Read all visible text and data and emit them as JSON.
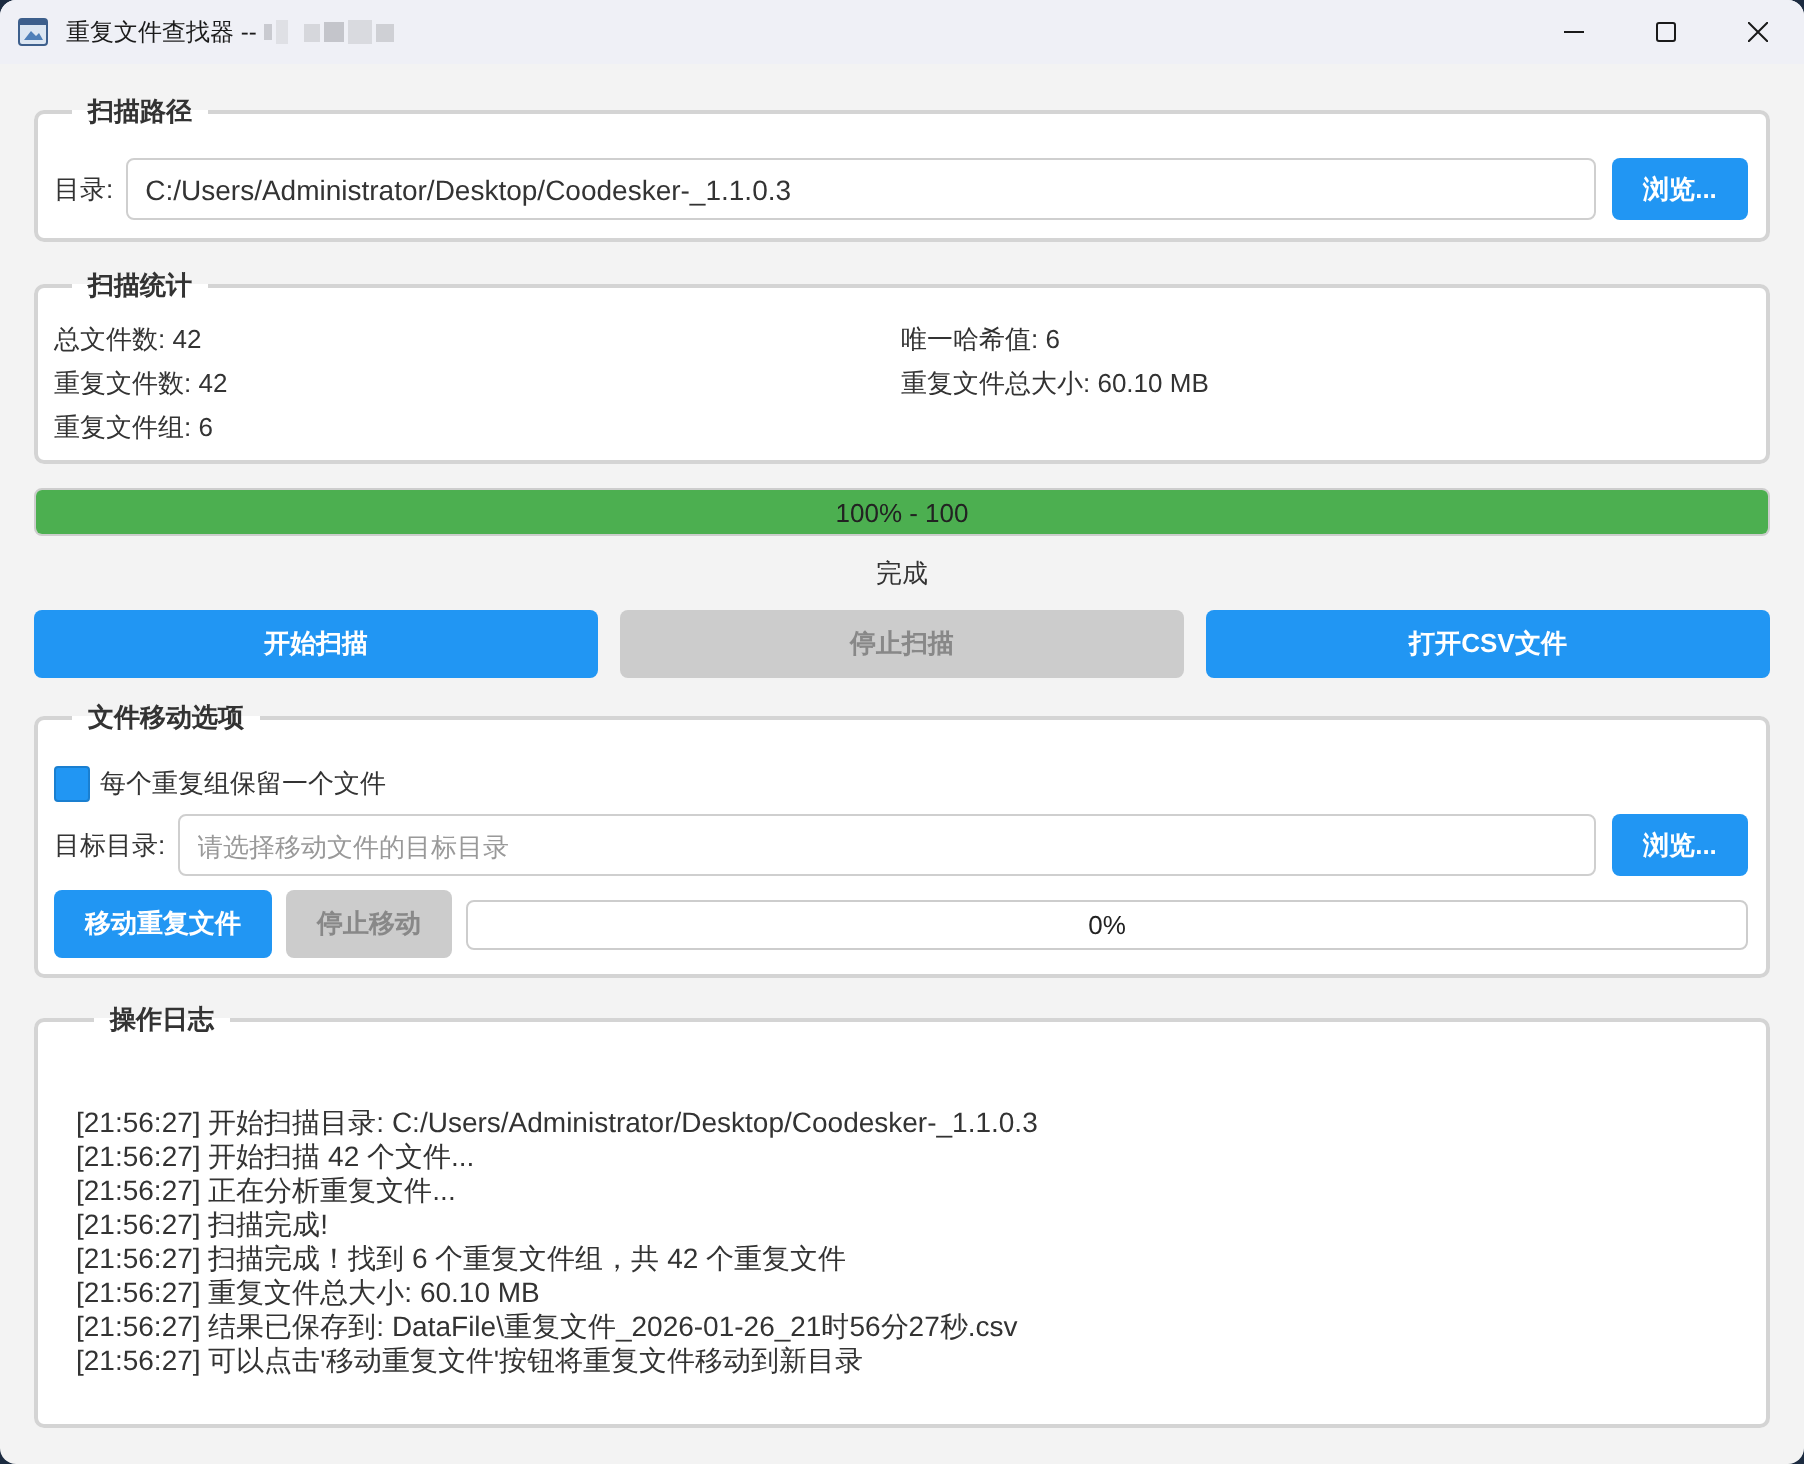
{
  "window": {
    "title": "重复文件查找器 --"
  },
  "scan_path": {
    "title": "扫描路径",
    "label": "目录:",
    "value": "C:/Users/Administrator/Desktop/Coodesker-_1.1.0.3",
    "browse_button": "浏览..."
  },
  "scan_stats": {
    "title": "扫描统计",
    "items": [
      "总文件数: 42",
      "唯一哈希值: 6",
      "重复文件数: 42",
      "重复文件总大小: 60.10 MB",
      "重复文件组: 6"
    ]
  },
  "scan_progress": {
    "level": 1.0,
    "text": "100% - 100"
  },
  "status": "完成",
  "actions": [
    {
      "label": "开始扫描",
      "disabled": false
    },
    {
      "label": "停止扫描",
      "disabled": true
    },
    {
      "label": "打开CSV文件",
      "disabled": false
    }
  ],
  "move_options": {
    "title": "文件移动选项",
    "keep_one": {
      "label": "每个重复组保留一个文件",
      "checked": true
    },
    "target_label": "目标目录:",
    "target_placeholder": "请选择移动文件的目标目录",
    "browse_button": "浏览...",
    "buttons": [
      {
        "label": "移动重复文件",
        "disabled": false
      },
      {
        "label": "停止移动",
        "disabled": true
      }
    ],
    "progress": {
      "level": 0,
      "text": "0%"
    }
  },
  "log": {
    "title": "操作日志",
    "lines": [
      "[21:56:27] 开始扫描目录: C:/Users/Administrator/Desktop/Coodesker-_1.1.0.3",
      "[21:56:27] 开始扫描 42 个文件...",
      "[21:56:27] 正在分析重复文件...",
      "[21:56:27] 扫描完成!",
      "[21:56:27] 扫描完成！找到 6 个重复文件组，共 42 个重复文件",
      "[21:56:27] 重复文件总大小: 60.10 MB",
      "[21:56:27] 结果已保存到: DataFile\\重复文件_2026-01-26_21时56分27秒.csv",
      "[21:56:27] 可以点击'移动重复文件'按钮将重复文件移动到新目录"
    ]
  }
}
